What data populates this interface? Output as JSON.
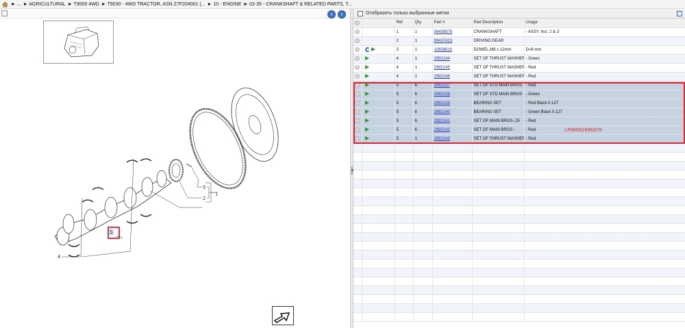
{
  "breadcrumb": {
    "items": [
      "► ...",
      "► AGRICULTURAL",
      "► T9000 4WD",
      "► T9030 - 4WD TRACTOR, ASN Z7F204001 (...",
      "► 10 - ENGINE",
      "► 02-35 - CRANKSHAFT & RELATED PARTS, T..."
    ]
  },
  "diagram": {
    "callouts": [
      "1",
      "2",
      "3",
      "4",
      "5"
    ],
    "selected_ref": "5"
  },
  "table": {
    "filter_label": "Отобразить только выбранные метки",
    "columns": [
      "Ref",
      "Qty",
      "Part #",
      "Part Description",
      "Usage"
    ],
    "rows": [
      {
        "ref": "1",
        "qty": "1",
        "part": "99438979",
        "desc": "CRANKSHAFT",
        "usage": "- ASSY, Incl. 2 & 3",
        "icons": []
      },
      {
        "ref": "2",
        "qty": "1",
        "part": "99437423",
        "desc": "DRIVING GEAR",
        "usage": "",
        "icons": []
      },
      {
        "ref": "3",
        "qty": "1",
        "part": "10838610",
        "desc": "DOWEL,M8 x 12mm",
        "usage": "D=8 mm",
        "icons": [
          "swap",
          "arrow"
        ]
      },
      {
        "ref": "4",
        "qty": "1",
        "part": "2992144",
        "desc": "SET OF THRUST WASHER",
        "usage": "- Green",
        "icons": [
          "arrow"
        ]
      },
      {
        "ref": "4",
        "qty": "1",
        "part": "2992145",
        "desc": "SET OF THRUST WASHER",
        "usage": "- Red",
        "icons": [
          "arrow"
        ]
      },
      {
        "ref": "4",
        "qty": "1",
        "part": "2992146",
        "desc": "SET OF THRUST WASHER",
        "usage": "- Red",
        "icons": [
          "arrow"
        ]
      },
      {
        "ref": "5",
        "qty": "6",
        "part": "2992137",
        "desc": "SET OF STD MAIN BRGS",
        "usage": "- Red",
        "icons": [
          "arrow"
        ],
        "selected": true
      },
      {
        "ref": "5",
        "qty": "6",
        "part": "2992138",
        "desc": "SET OF STD MAIN BRGS",
        "usage": "- Green",
        "icons": [
          "arrow"
        ],
        "selected": true
      },
      {
        "ref": "5",
        "qty": "6",
        "part": "2992139",
        "desc": "BEARING SET",
        "usage": "- Red Black 0.127",
        "icons": [
          "arrow"
        ],
        "selected": true
      },
      {
        "ref": "5",
        "qty": "6",
        "part": "2992140",
        "desc": "BEARING SET",
        "usage": "- Green Black 0.127",
        "icons": [
          "arrow"
        ],
        "selected": true
      },
      {
        "ref": "5",
        "qty": "6",
        "part": "2992141",
        "desc": "SET OF MAIN BRGS-.25",
        "usage": "- Red",
        "icons": [
          "arrow"
        ],
        "selected": true
      },
      {
        "ref": "5",
        "qty": "6",
        "part": "2992142",
        "desc": "SET OF MAIN BRGS   -",
        "usage": "- Red",
        "icons": [
          "arrow"
        ],
        "selected": true
      },
      {
        "ref": "5",
        "qty": "1",
        "part": "2992143",
        "desc": "SET OF THRUST WASHER",
        "usage": "- Red",
        "icons": [
          "arrow"
        ],
        "selected": true
      }
    ]
  },
  "watermark": "LP00502996970",
  "colors": {
    "highlight": "#e0202a",
    "link": "#1a33cc",
    "selected_row": "#c5d2df"
  }
}
